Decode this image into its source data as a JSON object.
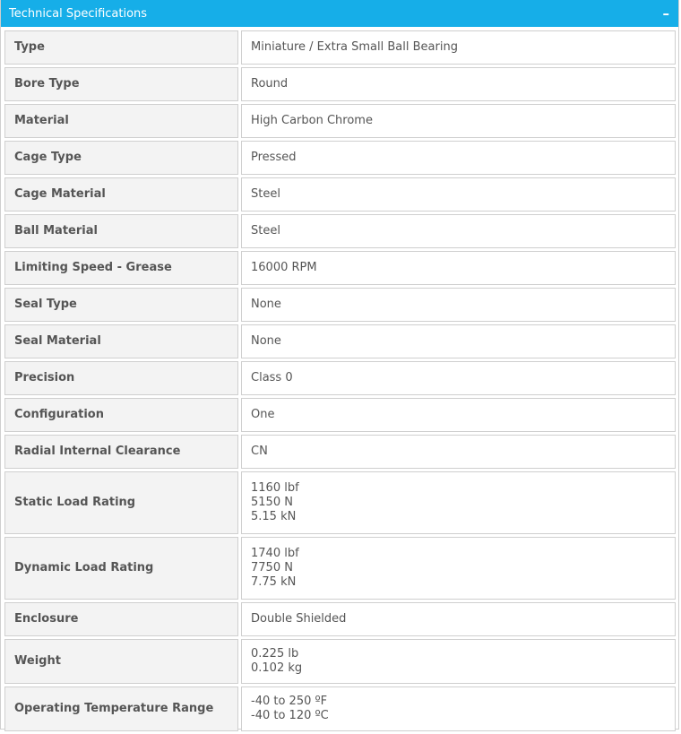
{
  "header": {
    "title": "Technical Specifications",
    "collapse_glyph": "–",
    "accent": "#16aee8"
  },
  "specs": [
    {
      "label": "Type",
      "values": [
        "Miniature / Extra Small Ball Bearing"
      ]
    },
    {
      "label": "Bore Type",
      "values": [
        "Round"
      ]
    },
    {
      "label": "Material",
      "values": [
        "High Carbon Chrome"
      ]
    },
    {
      "label": "Cage Type",
      "values": [
        "Pressed"
      ]
    },
    {
      "label": "Cage Material",
      "values": [
        "Steel"
      ]
    },
    {
      "label": "Ball Material",
      "values": [
        "Steel"
      ]
    },
    {
      "label": "Limiting Speed - Grease",
      "values": [
        "16000 RPM"
      ]
    },
    {
      "label": "Seal Type",
      "values": [
        "None"
      ]
    },
    {
      "label": "Seal Material",
      "values": [
        "None"
      ]
    },
    {
      "label": "Precision",
      "values": [
        "Class 0"
      ]
    },
    {
      "label": "Configuration",
      "values": [
        "One"
      ]
    },
    {
      "label": "Radial Internal Clearance",
      "values": [
        "CN"
      ]
    },
    {
      "label": "Static Load Rating",
      "values": [
        "1160 lbf",
        "5150 N",
        "5.15 kN"
      ]
    },
    {
      "label": "Dynamic Load Rating",
      "values": [
        "1740 lbf",
        "7750 N",
        "7.75 kN"
      ]
    },
    {
      "label": "Enclosure",
      "values": [
        "Double Shielded"
      ]
    },
    {
      "label": "Weight",
      "values": [
        "0.225 lb",
        "0.102 kg"
      ]
    },
    {
      "label": "Operating Temperature Range",
      "values": [
        "-40 to 250 ºF",
        "-40 to 120 ºC"
      ]
    }
  ]
}
